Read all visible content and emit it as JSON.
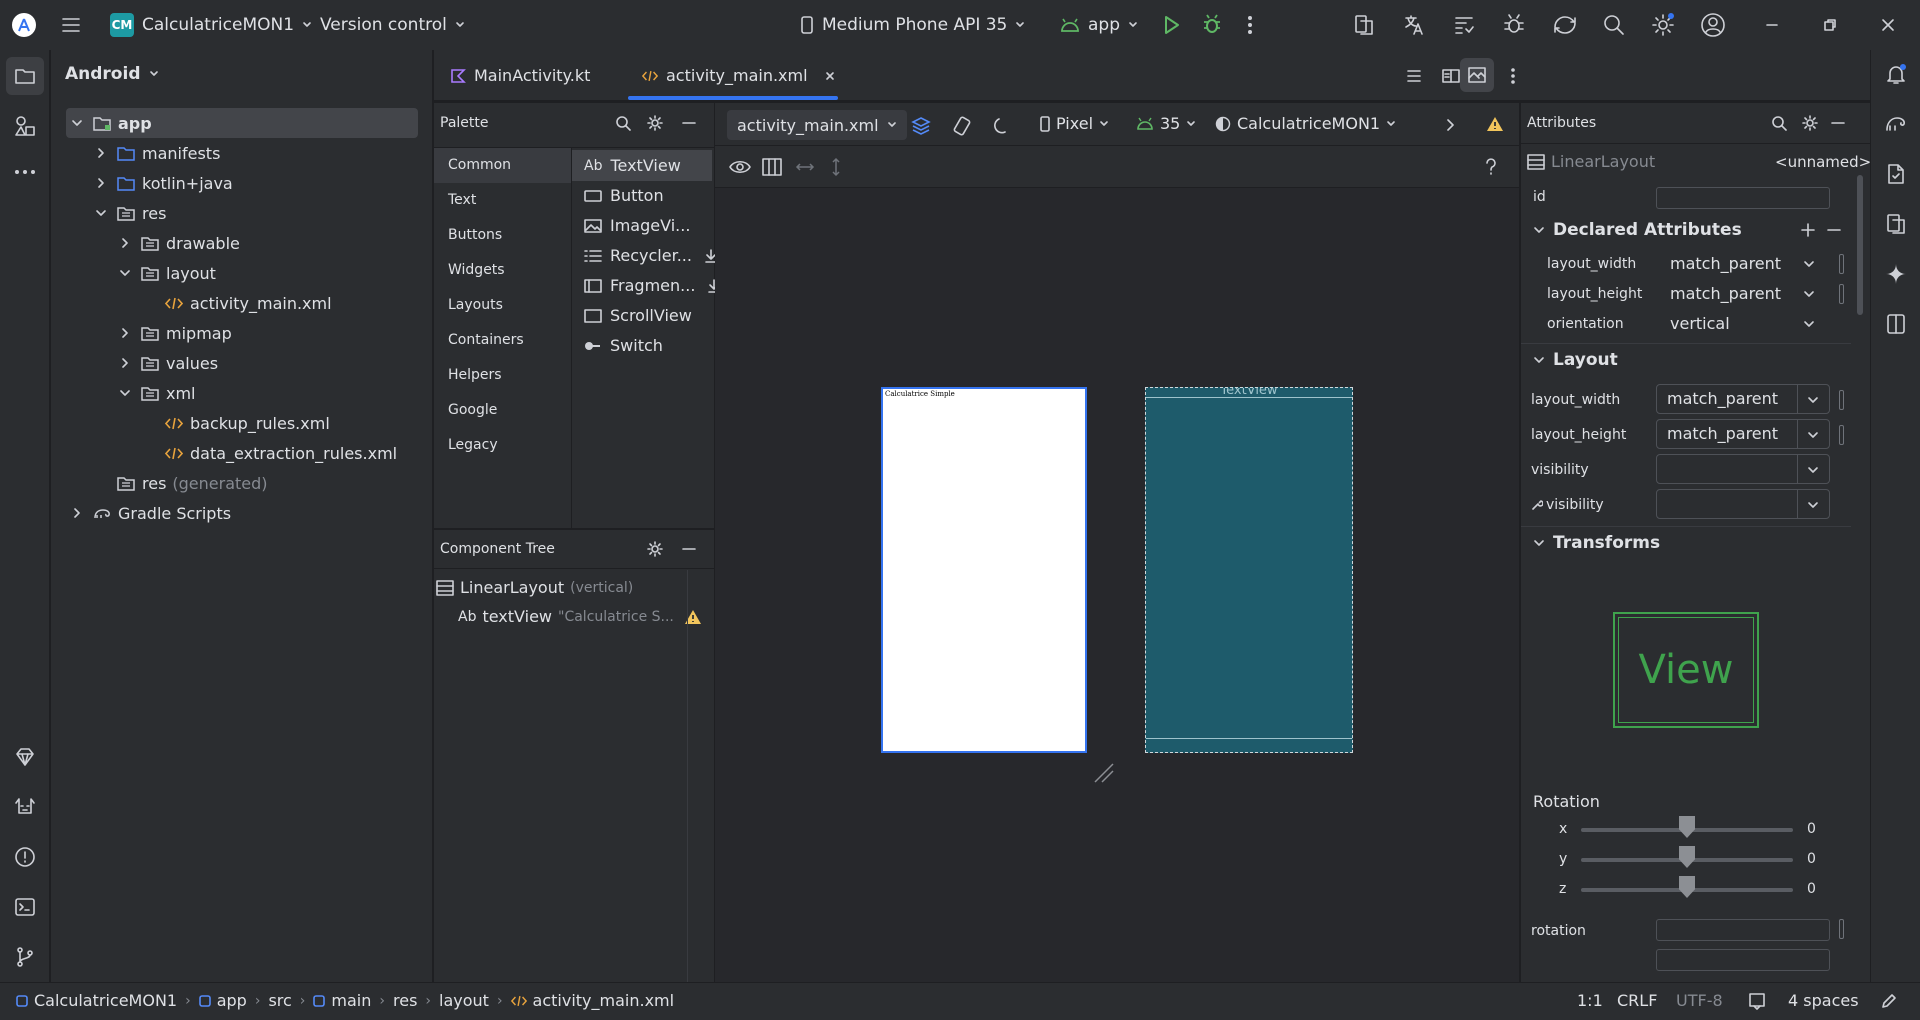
{
  "titlebar": {
    "project_badge": "CM",
    "project_name": "CalculatriceMON1",
    "version_control": "Version control",
    "device": "Medium Phone API 35",
    "run_config": "app"
  },
  "project_panel": {
    "view_mode": "Android",
    "tree": [
      {
        "label": "app",
        "level": 0
      },
      {
        "label": "manifests",
        "level": 1
      },
      {
        "label": "kotlin+java",
        "level": 1
      },
      {
        "label": "res",
        "level": 1
      },
      {
        "label": "drawable",
        "level": 2
      },
      {
        "label": "layout",
        "level": 2
      },
      {
        "label": "activity_main.xml",
        "level": 3
      },
      {
        "label": "mipmap",
        "level": 2
      },
      {
        "label": "values",
        "level": 2
      },
      {
        "label": "xml",
        "level": 2
      },
      {
        "label": "backup_rules.xml",
        "level": 3
      },
      {
        "label": "data_extraction_rules.xml",
        "level": 3
      },
      {
        "label": "res",
        "suffix": "(generated)",
        "level": 1
      },
      {
        "label": "Gradle Scripts",
        "level": 0
      }
    ]
  },
  "tabs": [
    {
      "label": "MainActivity.kt"
    },
    {
      "label": "activity_main.xml"
    }
  ],
  "palette": {
    "title": "Palette",
    "categories": [
      "Common",
      "Text",
      "Buttons",
      "Widgets",
      "Layouts",
      "Containers",
      "Helpers",
      "Google",
      "Legacy"
    ],
    "items": [
      "TextView",
      "Button",
      "ImageVi...",
      "Recycler...",
      "Fragmen...",
      "ScrollView",
      "Switch"
    ],
    "textview_prefix": "Ab"
  },
  "component_tree": {
    "title": "Component Tree",
    "root": "LinearLayout",
    "root_suffix": "(vertical)",
    "child_prefix": "Ab",
    "child": "textView",
    "child_text": "\"Calculatrice S..."
  },
  "design_toolbar": {
    "file": "activity_main.xml",
    "device": "Pixel",
    "api": "35",
    "theme": "CalculatriceMON1"
  },
  "canvas": {
    "preview_text": "Calculatrice Simple",
    "blueprint_label": "TextView"
  },
  "attributes": {
    "title": "Attributes",
    "component": "LinearLayout",
    "component_name": "<unnamed>",
    "id_label": "id",
    "declared_title": "Declared Attributes",
    "declared": [
      {
        "name": "layout_width",
        "value": "match_parent"
      },
      {
        "name": "layout_height",
        "value": "match_parent"
      },
      {
        "name": "orientation",
        "value": "vertical"
      }
    ],
    "layout_title": "Layout",
    "layout": [
      {
        "name": "layout_width",
        "value": "match_parent"
      },
      {
        "name": "layout_height",
        "value": "match_parent"
      },
      {
        "name": "visibility",
        "value": ""
      },
      {
        "name": "visibility",
        "value": ""
      }
    ],
    "transforms_title": "Transforms",
    "view_label": "View",
    "rotation_title": "Rotation",
    "rotation": [
      {
        "axis": "x",
        "value": "0"
      },
      {
        "axis": "y",
        "value": "0"
      },
      {
        "axis": "z",
        "value": "0"
      }
    ],
    "rotation_field_label": "rotation"
  },
  "statusbar": {
    "crumbs": [
      "CalculatriceMON1",
      "app",
      "src",
      "main",
      "res",
      "layout",
      "activity_main.xml"
    ],
    "position": "1:1",
    "line_ending": "CRLF",
    "encoding": "UTF-8",
    "indent": "4 spaces"
  },
  "colors": {
    "accent": "#3574f0",
    "warning": "#f2c55c",
    "blueprint": "#1e5b6b",
    "xml_icon": "#e8a33d"
  }
}
